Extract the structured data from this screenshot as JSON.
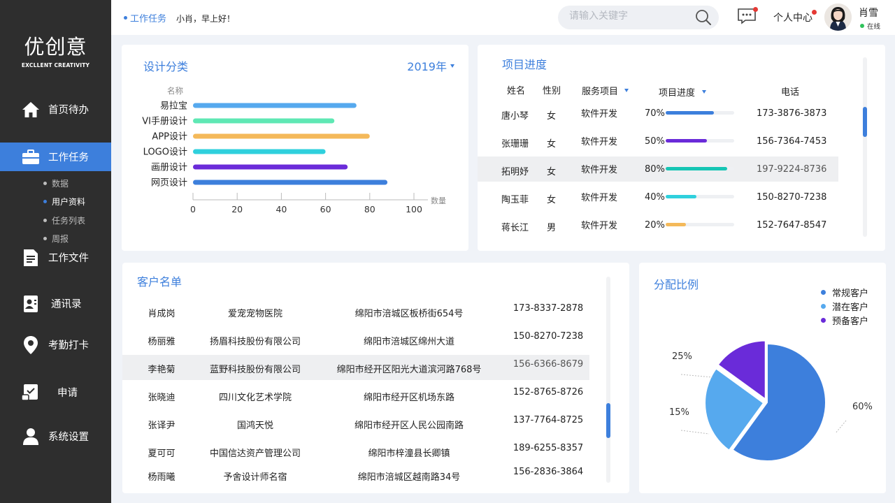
{
  "logo": {
    "main": "优创意",
    "sub": "EXCLLENT CREATIVITY"
  },
  "nav": [
    {
      "label": "首页待办",
      "icon": "home-icon"
    },
    {
      "label": "工作任务",
      "icon": "briefcase-icon"
    },
    {
      "label": "工作文件",
      "icon": "document-icon"
    },
    {
      "label": "通讯录",
      "icon": "contacts-icon"
    },
    {
      "label": "考勤打卡",
      "icon": "location-pin-icon"
    },
    {
      "label": "申请",
      "icon": "application-icon"
    },
    {
      "label": "系统设置",
      "icon": "user-icon"
    }
  ],
  "subnav": [
    "数据",
    "用户资料",
    "任务列表",
    "周报"
  ],
  "header": {
    "breadcrumb": "工作任务",
    "greeting": "小肖，早上好！",
    "search_placeholder": "请输入关键字",
    "personal_center": "个人中心",
    "user_name": "肖雪",
    "user_status": "在线"
  },
  "design": {
    "title": "设计分类",
    "year": "2019年"
  },
  "chart_data": {
    "type": "bar",
    "orientation": "horizontal",
    "title": "设计分类",
    "ylabel": "名称",
    "xlabel": "数量",
    "categories": [
      "易拉宝",
      "VI手册设计",
      "APP设计",
      "LOGO设计",
      "画册设计",
      "网页设计"
    ],
    "values": [
      74,
      64,
      80,
      60,
      70,
      88
    ],
    "colors": [
      "#56a9ee",
      "#5fe8b4",
      "#f4b95a",
      "#2fd0dd",
      "#6a2bd9",
      "#3d7fdc"
    ],
    "ticks": [
      "0",
      "20",
      "40",
      "60",
      "80",
      "100"
    ],
    "xlim": [
      0,
      100
    ],
    "grid": false
  },
  "progress": {
    "title": "项目进度",
    "headers": {
      "name": "姓名",
      "gender": "性别",
      "service": "服务项目",
      "progress": "项目进度",
      "phone": "电话"
    },
    "rows": [
      {
        "name": "唐小琴",
        "gender": "女",
        "service": "软件开发",
        "pct": "70%",
        "value": 0.7,
        "color": "#3d7fdc",
        "phone": "173-3876-3873"
      },
      {
        "name": "张珊珊",
        "gender": "女",
        "service": "软件开发",
        "pct": "50%",
        "value": 0.6,
        "color": "#6a2bd9",
        "phone": "156-7364-7453"
      },
      {
        "name": "拓明妤",
        "gender": "女",
        "service": "软件开发",
        "pct": "80%",
        "value": 0.9,
        "color": "#16c5b4",
        "phone": "197-9224-8736"
      },
      {
        "name": "陶玉菲",
        "gender": "女",
        "service": "软件开发",
        "pct": "40%",
        "value": 0.45,
        "color": "#2fd0dd",
        "phone": "150-8270-7238"
      },
      {
        "name": "蒋长江",
        "gender": "男",
        "service": "软件开发",
        "pct": "20%",
        "value": 0.3,
        "color": "#f4b95a",
        "phone": "152-7647-8547"
      }
    ]
  },
  "customers": {
    "title": "客户名单",
    "rows": [
      {
        "name": "肖成岗",
        "company": "爱宠宠物医院",
        "address": "绵阳市涪城区板桥街654号",
        "phone": "173-8337-2878"
      },
      {
        "name": "杨丽雅",
        "company": "扬眉科技股份有限公司",
        "address": "绵阳市涪城区绵州大道",
        "phone": "150-8270-7238"
      },
      {
        "name": "李艳菊",
        "company": "蓝野科技股份有限公司",
        "address": "绵阳市经开区阳光大道滨河路768号",
        "phone": "156-6366-8679"
      },
      {
        "name": "张晓迪",
        "company": "四川文化艺术学院",
        "address": "绵阳市经开区机场东路",
        "phone": "152-8765-8726"
      },
      {
        "name": "张译尹",
        "company": "国鸿天悦",
        "address": "绵阳市经开区人民公园南路",
        "phone": "137-7764-8725"
      },
      {
        "name": "夏可可",
        "company": "中国信达资产管理公司",
        "address": "绵阳市梓潼县长卿镇",
        "phone": "189-6255-8357"
      },
      {
        "name": "杨雨曦",
        "company": "予舍设计师名宿",
        "address": "绵阳市涪城区越南路34号",
        "phone": "156-2836-3864"
      }
    ]
  },
  "pie": {
    "title": "分配比例",
    "legend": [
      "常规客户",
      "潜在客户",
      "预备客户"
    ],
    "colors": [
      "#3d7fdc",
      "#56a9ee",
      "#6a2bd9"
    ],
    "slices": [
      {
        "label": "常规客户",
        "value": 60,
        "text": "60%"
      },
      {
        "label": "潜在客户",
        "value": 25,
        "text": "25%"
      },
      {
        "label": "预备客户",
        "value": 15,
        "text": "15%"
      }
    ]
  }
}
